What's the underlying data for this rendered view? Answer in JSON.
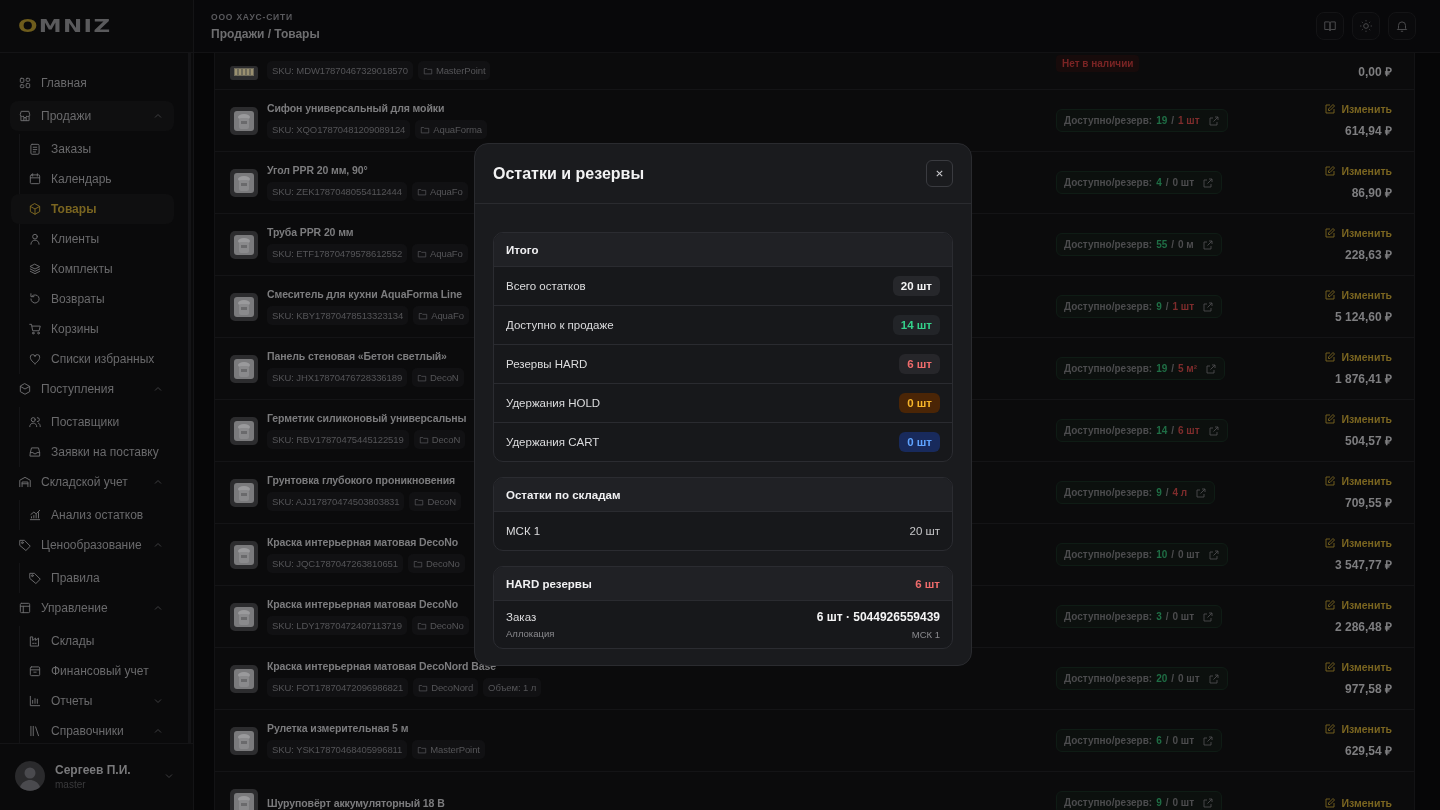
{
  "logo": {
    "accent": "O",
    "rest": "MNIZ"
  },
  "sidebar": {
    "items": [
      {
        "label": "Главная",
        "selected": false
      },
      {
        "label": "Продажи",
        "selected": false,
        "expanded": true,
        "children": [
          {
            "label": "Заказы",
            "selected": false
          },
          {
            "label": "Календарь",
            "selected": false
          },
          {
            "label": "Товары",
            "selected": true
          },
          {
            "label": "Клиенты",
            "selected": false
          },
          {
            "label": "Комплекты",
            "selected": false
          },
          {
            "label": "Возвраты",
            "selected": false
          },
          {
            "label": "Корзины",
            "selected": false
          },
          {
            "label": "Списки избранных",
            "selected": false
          }
        ]
      },
      {
        "label": "Поступления",
        "selected": false,
        "expanded": true,
        "children": [
          {
            "label": "Поставщики",
            "selected": false
          },
          {
            "label": "Заявки на поставку",
            "selected": false
          }
        ]
      },
      {
        "label": "Складской учет",
        "selected": false,
        "expanded": true,
        "children": [
          {
            "label": "Анализ остатков",
            "selected": false
          }
        ]
      },
      {
        "label": "Ценообразование",
        "selected": false,
        "expanded": true,
        "children": [
          {
            "label": "Правила",
            "selected": false
          }
        ]
      },
      {
        "label": "Управление",
        "selected": false,
        "expanded": true,
        "children": [
          {
            "label": "Склады",
            "selected": false
          },
          {
            "label": "Финансовый учет",
            "selected": false
          },
          {
            "label": "Отчеты",
            "selected": false,
            "expanded": false
          },
          {
            "label": "Справочники",
            "selected": false,
            "expanded": true
          }
        ]
      }
    ]
  },
  "user": {
    "name": "Сергеев П.И.",
    "role": "master"
  },
  "header": {
    "company": "ООО ХАУС-СИТИ",
    "breadcrumb": "Продажи / Товары"
  },
  "products": [
    {
      "kind": "partial",
      "sku": "SKU: MDW17870467329018570",
      "brand": "MasterPoint",
      "status": {
        "kind": "out",
        "label": "Нет в наличии"
      },
      "price": "0,00 ₽"
    },
    {
      "kind": "full",
      "name": "Сифон универсальный для мойки",
      "sku": "SKU: XQO17870481209089124",
      "brand": "AquaForma",
      "status": {
        "kind": "stock",
        "label": "Доступно/резерв:",
        "available": "19",
        "slash": "/",
        "reserve": "1 шт",
        "reserved": true
      },
      "edit": "Изменить",
      "price": "614,94 ₽"
    },
    {
      "kind": "full",
      "name": "Угол PPR 20 мм, 90°",
      "sku": "SKU: ZEK17870480554112444",
      "brand": "AquaFo",
      "status": {
        "kind": "stock",
        "label": "Доступно/резерв:",
        "available": "4",
        "slash": "/",
        "reserve": "0 шт",
        "reserved": false
      },
      "edit": "Изменить",
      "price": "86,90 ₽"
    },
    {
      "kind": "full",
      "name": "Труба PPR 20 мм",
      "sku": "SKU: ETF17870479578612552",
      "brand": "AquaFo",
      "status": {
        "kind": "stock",
        "label": "Доступно/резерв:",
        "available": "55",
        "slash": "/",
        "reserve": "0 м",
        "reserved": false
      },
      "edit": "Изменить",
      "price": "228,63 ₽"
    },
    {
      "kind": "full",
      "name": "Смеситель для кухни AquaForma Line",
      "sku": "SKU: KBY17870478513323134",
      "brand": "AquaFo",
      "status": {
        "kind": "stock",
        "label": "Доступно/резерв:",
        "available": "9",
        "slash": "/",
        "reserve": "1 шт",
        "reserved": true
      },
      "edit": "Изменить",
      "price": "5 124,60 ₽"
    },
    {
      "kind": "full",
      "name": "Панель стеновая «Бетон светлый»",
      "sku": "SKU: JHX17870476728336189",
      "brand": "DecoN",
      "status": {
        "kind": "stock",
        "label": "Доступно/резерв:",
        "available": "19",
        "slash": "/",
        "reserve": "5 м²",
        "reserved": true
      },
      "edit": "Изменить",
      "price": "1 876,41 ₽"
    },
    {
      "kind": "full",
      "name": "Герметик силиконовый универсальны",
      "sku": "SKU: RBV17870475445122519",
      "brand": "DecoN",
      "status": {
        "kind": "stock",
        "label": "Доступно/резерв:",
        "available": "14",
        "slash": "/",
        "reserve": "6 шт",
        "reserved": true
      },
      "edit": "Изменить",
      "price": "504,57 ₽"
    },
    {
      "kind": "full",
      "name": "Грунтовка глубокого проникновения",
      "sku": "SKU: AJJ17870474503803831",
      "brand": "DecoN",
      "status": {
        "kind": "stock",
        "label": "Доступно/резерв:",
        "available": "9",
        "slash": "/",
        "reserve": "4 л",
        "reserved": true
      },
      "edit": "Изменить",
      "price": "709,55 ₽"
    },
    {
      "kind": "full",
      "name": "Краска интерьерная матовая DecoNo",
      "sku": "SKU: JQC1787047263810651",
      "brand": "DecoNo",
      "status": {
        "kind": "stock",
        "label": "Доступно/резерв:",
        "available": "10",
        "slash": "/",
        "reserve": "0 шт",
        "reserved": false
      },
      "edit": "Изменить",
      "price": "3 547,77 ₽"
    },
    {
      "kind": "full",
      "name": "Краска интерьерная матовая DecoNo",
      "sku": "SKU: LDY17870472407113719",
      "brand": "DecoNo",
      "status": {
        "kind": "stock",
        "label": "Доступно/резерв:",
        "available": "3",
        "slash": "/",
        "reserve": "0 шт",
        "reserved": false
      },
      "edit": "Изменить",
      "price": "2 286,48 ₽"
    },
    {
      "kind": "full",
      "name": "Краска интерьерная матовая DecoNord Base",
      "sku": "SKU: FOT17870472096986821",
      "brand": "DecoNord",
      "extra": "Объем: 1 л",
      "status": {
        "kind": "stock",
        "label": "Доступно/резерв:",
        "available": "20",
        "slash": "/",
        "reserve": "0 шт",
        "reserved": false
      },
      "edit": "Изменить",
      "price": "977,58 ₽"
    },
    {
      "kind": "full",
      "name": "Рулетка измерительная 5 м",
      "sku": "SKU: YSK17870468405996811",
      "brand": "MasterPoint",
      "status": {
        "kind": "stock",
        "label": "Доступно/резерв:",
        "available": "6",
        "slash": "/",
        "reserve": "0 шт",
        "reserved": false
      },
      "edit": "Изменить",
      "price": "629,54 ₽"
    },
    {
      "kind": "cut",
      "name": "Шуруповёрт аккумуляторный 18 В",
      "status": {
        "kind": "stock",
        "label": "Доступно/резерв:",
        "available": "9",
        "slash": "/",
        "reserve": "0 шт",
        "reserved": false
      },
      "edit": "Изменить"
    }
  ],
  "modal": {
    "title": "Остатки и резервы",
    "sections": [
      {
        "kind": "summary",
        "title": "Итого",
        "rows": [
          {
            "kind": "total",
            "label": "Всего остатков",
            "value": "20 шт"
          },
          {
            "kind": "available",
            "label": "Доступно к продаже",
            "value": "14 шт"
          },
          {
            "kind": "hard",
            "label": "Резервы HARD",
            "value": "6 шт"
          },
          {
            "kind": "hold",
            "label": "Удержания HOLD",
            "value": "0 шт"
          },
          {
            "kind": "cart",
            "label": "Удержания CART",
            "value": "0 шт"
          }
        ]
      },
      {
        "kind": "stock",
        "title": "Остатки по складам",
        "rows": [
          {
            "label": "МСК 1",
            "value": "20 шт"
          }
        ]
      },
      {
        "kind": "reserves",
        "title": "HARD резервы",
        "total": "6 шт",
        "rows": [
          {
            "label": "Заказ",
            "sublabel": "Аллокация",
            "value": "6 шт · 5044926559439",
            "subvalue": "МСК 1"
          }
        ]
      }
    ]
  }
}
